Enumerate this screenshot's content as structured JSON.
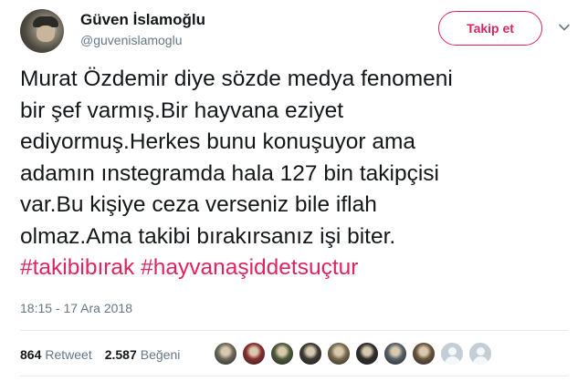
{
  "author": {
    "display_name": "Güven İslamoğlu",
    "handle": "@guvenislamoglu"
  },
  "follow_button": {
    "label": "Takip et"
  },
  "tweet": {
    "lines": [
      "Murat Özdemir diye sözde medya fenomeni",
      "bir şef varmış.Bir hayvana eziyet",
      "ediyormuş.Herkes bunu konuşuyor ama",
      "adamın ınstegramda hala 127 bin takipçisi",
      "var.Bu kişiye ceza verseniz bile iflah",
      "olmaz.Ama takibi bırakırsanız işi biter."
    ],
    "hashtags": [
      "#takibibırak",
      "#hayvanaşiddetsuçtur"
    ]
  },
  "timestamp": "18:15 - 17 Ara 2018",
  "stats": {
    "retweets": {
      "count": "864",
      "label": "Retweet"
    },
    "likes": {
      "count": "2.587",
      "label": "Beğeni"
    }
  },
  "likers": [
    {
      "color": "#6d6a5c"
    },
    {
      "color": "#8a2e2e"
    },
    {
      "color": "#4d5a3a"
    },
    {
      "color": "#3c3a36"
    },
    {
      "color": "#7a6a4e"
    },
    {
      "color": "#2e2d2b"
    },
    {
      "color": "#57606a"
    },
    {
      "color": "#6b5540"
    },
    {
      "color": "default"
    },
    {
      "color": "default"
    }
  ],
  "colors": {
    "accent": "#e0245e",
    "muted": "#657786",
    "text": "#14171a",
    "divider": "#e6ecf0"
  }
}
